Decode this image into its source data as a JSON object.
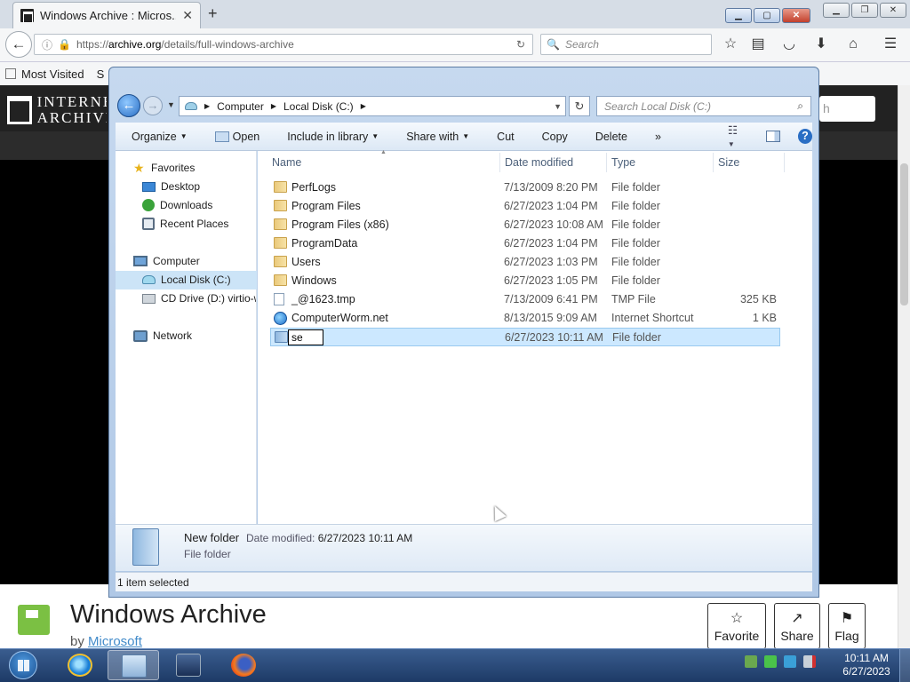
{
  "browser": {
    "tab_title": "Windows Archive : Micros...",
    "url_host": "archive.org",
    "url_scheme": "https://",
    "url_path": "/details/full-windows-archive",
    "search_placeholder": "Search",
    "bookmarks": [
      "Most Visited",
      "S"
    ]
  },
  "page": {
    "logo_text": "INTERNET ARCHIVE",
    "search_hint": "h",
    "title": "Windows Archive",
    "by_label": "by",
    "by_author": "Microsoft",
    "buttons": {
      "favorite": "Favorite",
      "share": "Share",
      "flag": "Flag"
    }
  },
  "explorer": {
    "breadcrumb": [
      "Computer",
      "Local Disk (C:)"
    ],
    "search_placeholder": "Search Local Disk (C:)",
    "commands": [
      "Organize",
      "Open",
      "Include in library",
      "Share with",
      "Cut",
      "Copy",
      "Delete",
      "»"
    ],
    "nav": {
      "favorites": "Favorites",
      "desktop": "Desktop",
      "downloads": "Downloads",
      "recent": "Recent Places",
      "computer": "Computer",
      "local_disk": "Local Disk (C:)",
      "cd_drive": "CD Drive (D:) virtio-w",
      "network": "Network"
    },
    "columns": {
      "name": "Name",
      "date": "Date modified",
      "type": "Type",
      "size": "Size"
    },
    "files": [
      {
        "name": "PerfLogs",
        "date": "7/13/2009 8:20 PM",
        "type": "File folder",
        "size": "",
        "icon": "folder"
      },
      {
        "name": "Program Files",
        "date": "6/27/2023 1:04 PM",
        "type": "File folder",
        "size": "",
        "icon": "folder"
      },
      {
        "name": "Program Files (x86)",
        "date": "6/27/2023 10:08 AM",
        "type": "File folder",
        "size": "",
        "icon": "folder"
      },
      {
        "name": "ProgramData",
        "date": "6/27/2023 1:04 PM",
        "type": "File folder",
        "size": "",
        "icon": "folder"
      },
      {
        "name": "Users",
        "date": "6/27/2023 1:03 PM",
        "type": "File folder",
        "size": "",
        "icon": "folder"
      },
      {
        "name": "Windows",
        "date": "6/27/2023 1:05 PM",
        "type": "File folder",
        "size": "",
        "icon": "folder"
      },
      {
        "name": "_@1623.tmp",
        "date": "7/13/2009 6:41 PM",
        "type": "TMP File",
        "size": "325 KB",
        "icon": "file"
      },
      {
        "name": "ComputerWorm.net",
        "date": "8/13/2015 9:09 AM",
        "type": "Internet Shortcut",
        "size": "1 KB",
        "icon": "ie"
      }
    ],
    "renaming_row": {
      "value": "se",
      "date": "6/27/2023 10:11 AM",
      "type": "File folder"
    },
    "details": {
      "name": "New folder",
      "date_label": "Date modified:",
      "date_value": "6/27/2023 10:11 AM",
      "type": "File folder"
    },
    "status": "1 item selected"
  },
  "taskbar": {
    "time": "10:11 AM",
    "date": "6/27/2023"
  }
}
